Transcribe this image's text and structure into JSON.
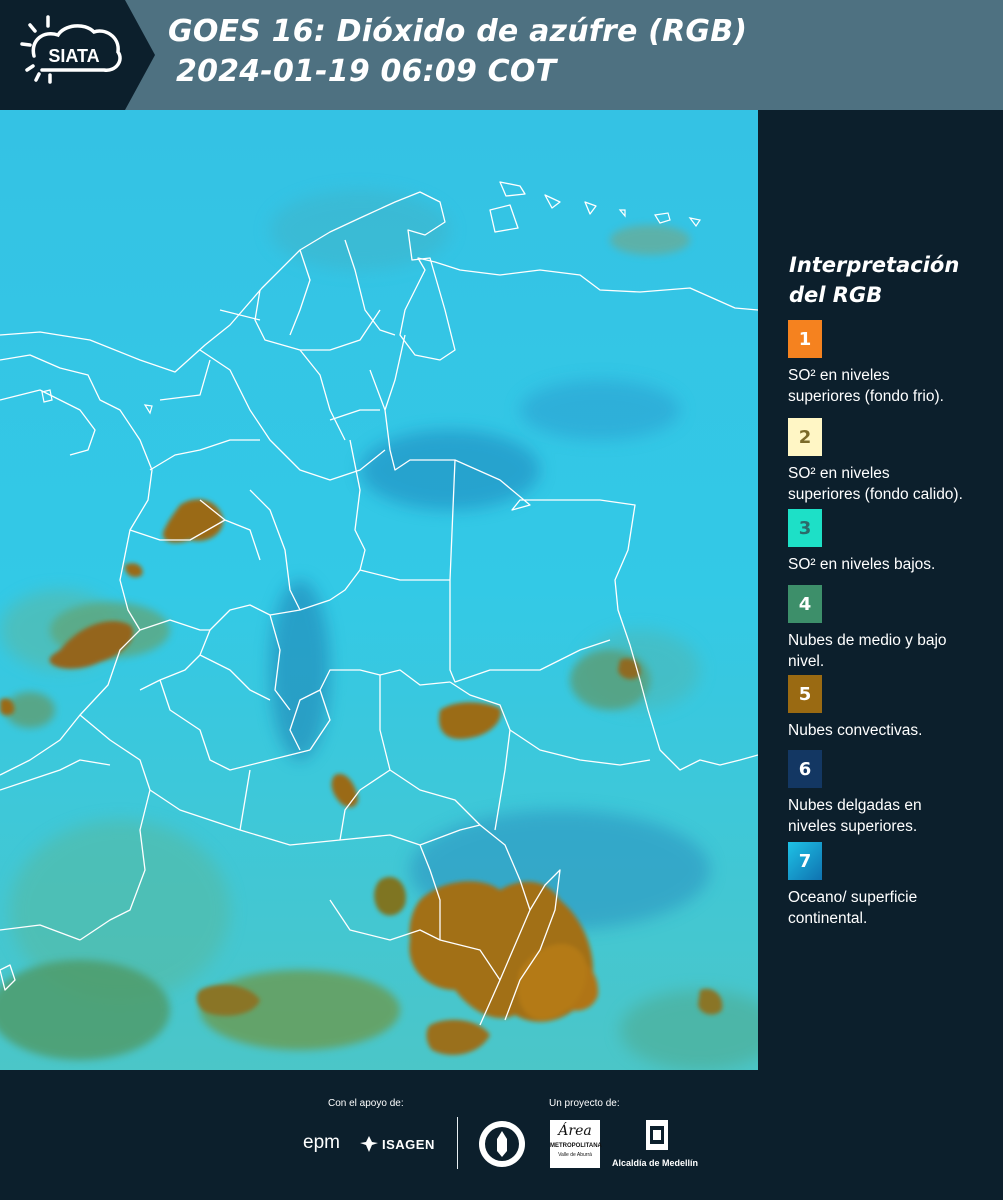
{
  "header": {
    "logo_text": "SIATA",
    "title_line1": "GOES 16: Dióxido de azúfre (RGB)",
    "title_line2": "2024-01-19 06:09 COT",
    "background_color": "#4e7181",
    "logo_tab_color": "#0c1f2c"
  },
  "legend": {
    "title": "Interpretación del RGB",
    "items": [
      {
        "number": "1",
        "label": "SO² en niveles superiores (fondo frio).",
        "color": "#f5821f"
      },
      {
        "number": "2",
        "label": "SO² en niveles superiores (fondo calido).",
        "color": "#fff6c5"
      },
      {
        "number": "3",
        "label": "SO² en niveles bajos.",
        "color": "#1de0c7"
      },
      {
        "number": "4",
        "label": "Nubes de medio y bajo nivel.",
        "color": "#3d8f6a"
      },
      {
        "number": "5",
        "label": "Nubes convectivas.",
        "color": "#9a6a12"
      },
      {
        "number": "6",
        "label": "Nubes delgadas en niveles superiores.",
        "color": "#133763"
      },
      {
        "number": "7",
        "label": "Oceano/ superficie continental.",
        "color": "#18a2cf"
      }
    ]
  },
  "map": {
    "background_color": "#2cc4e6",
    "cloud_colors": [
      "#9a6a12",
      "#6b7a2a",
      "#4c9a66",
      "#1e6fa0"
    ]
  },
  "footer": {
    "support_caption": "Con el apoyo de:",
    "project_caption": "Un proyecto de:",
    "sponsor_epm": "epm",
    "sponsor_isagen": "ISAGEN",
    "org_area_line1": "Área",
    "org_area_line2": "METROPOLITANA",
    "org_area_line3": "Valle de Aburrá",
    "org_alcaldia": "Alcaldía de Medellín"
  }
}
